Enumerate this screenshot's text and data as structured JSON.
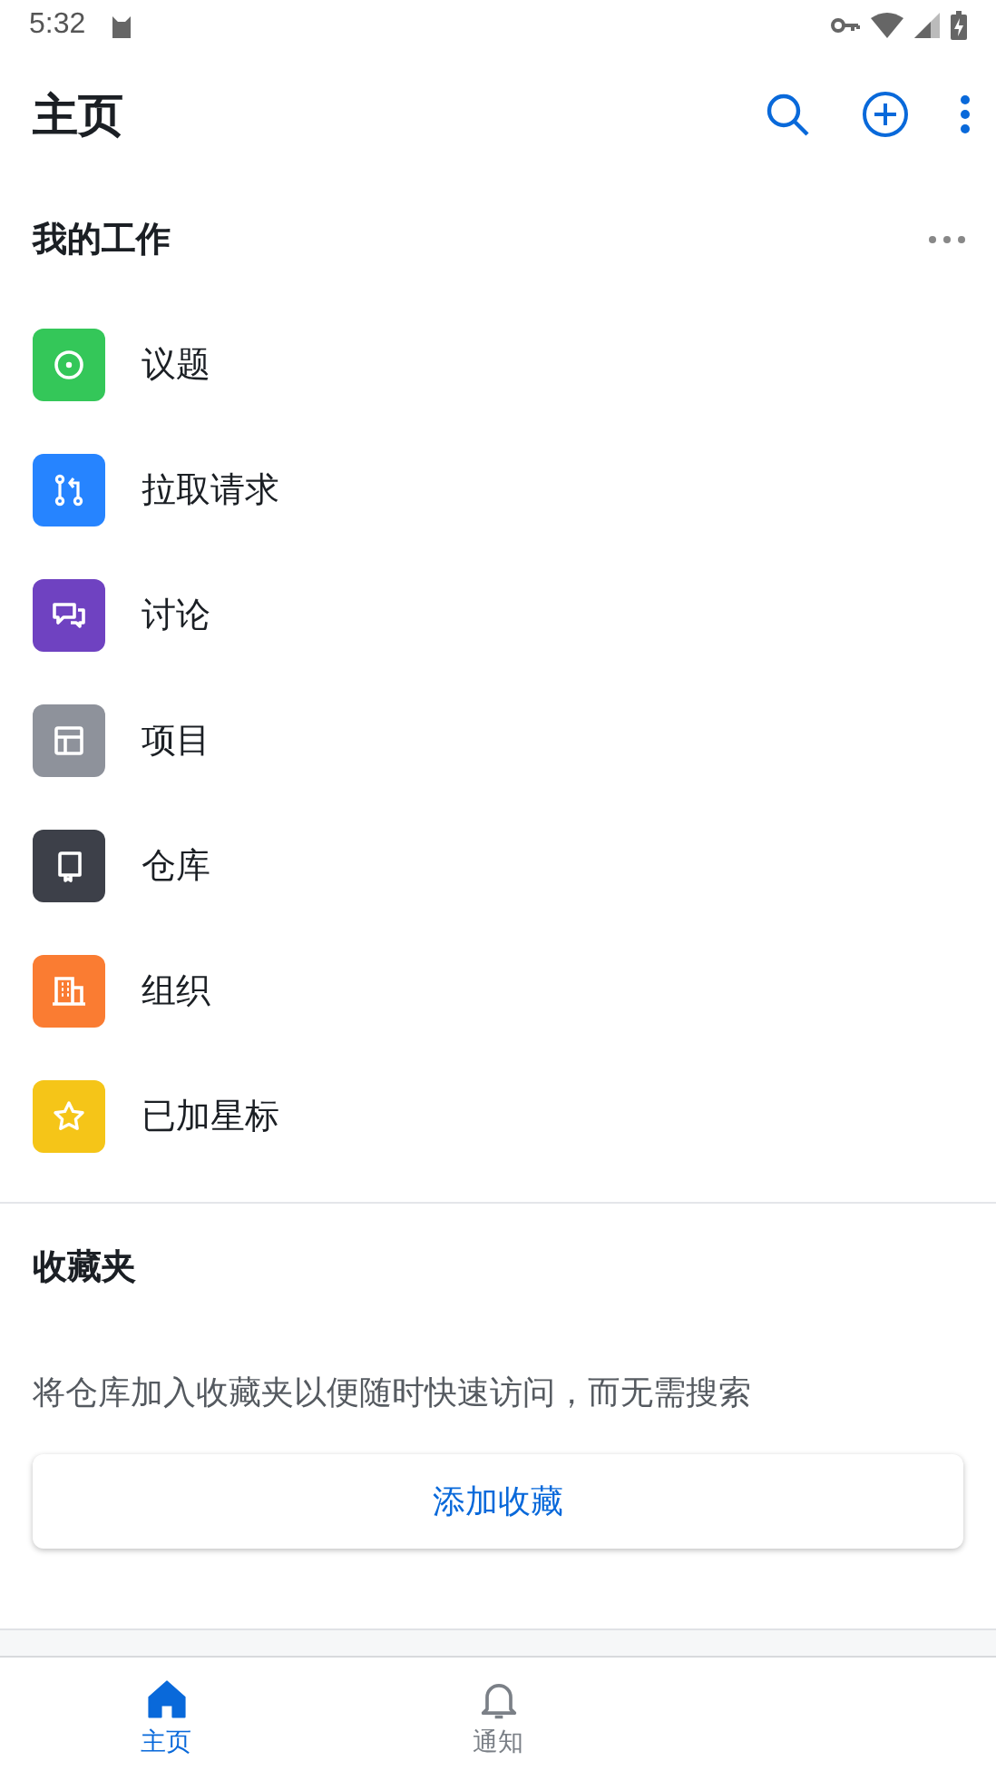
{
  "status_bar": {
    "time": "5:32"
  },
  "app_bar": {
    "title": "主页"
  },
  "my_work": {
    "title": "我的工作",
    "items": [
      {
        "label": "议题",
        "kind": "issues",
        "color": "#34c759"
      },
      {
        "label": "拉取请求",
        "kind": "pulls",
        "color": "#2684ff"
      },
      {
        "label": "讨论",
        "kind": "discussions",
        "color": "#6f42c1"
      },
      {
        "label": "项目",
        "kind": "projects",
        "color": "#8e929b"
      },
      {
        "label": "仓库",
        "kind": "repos",
        "color": "#3d4049"
      },
      {
        "label": "组织",
        "kind": "orgs",
        "color": "#fa7c32"
      },
      {
        "label": "已加星标",
        "kind": "starred",
        "color": "#f5c518"
      }
    ]
  },
  "favorites": {
    "title": "收藏夹",
    "description": "将仓库加入收藏夹以便随时快速访问，而无需搜索",
    "button": "添加收藏"
  },
  "bottom_nav": [
    {
      "label": "主页",
      "kind": "home",
      "selected": true
    },
    {
      "label": "通知",
      "kind": "bell",
      "selected": false
    }
  ]
}
